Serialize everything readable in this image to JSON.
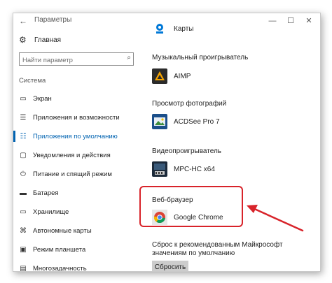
{
  "window": {
    "title": "Параметры"
  },
  "sidebar": {
    "home_label": "Главная",
    "search_placeholder": "Найти параметр",
    "section_label": "Система",
    "items": [
      {
        "label": "Экран",
        "icon": "display-icon"
      },
      {
        "label": "Приложения и возможности",
        "icon": "apps-list-icon"
      },
      {
        "label": "Приложения по умолчанию",
        "icon": "default-apps-icon",
        "active": true
      },
      {
        "label": "Уведомления и действия",
        "icon": "notifications-icon"
      },
      {
        "label": "Питание и спящий режим",
        "icon": "power-icon"
      },
      {
        "label": "Батарея",
        "icon": "battery-icon"
      },
      {
        "label": "Хранилище",
        "icon": "storage-icon"
      },
      {
        "label": "Автономные карты",
        "icon": "offline-maps-icon"
      },
      {
        "label": "Режим планшета",
        "icon": "tablet-mode-icon"
      },
      {
        "label": "Многозадачность",
        "icon": "multitasking-icon"
      }
    ]
  },
  "content": {
    "maps_app": "Карты",
    "music_title": "Музыкальный проигрыватель",
    "music_app": "AIMP",
    "photo_title": "Просмотр фотографий",
    "photo_app": "ACDSee Pro 7",
    "video_title": "Видеопроигрыватель",
    "video_app": "MPC-HC x64",
    "browser_title": "Веб-браузер",
    "browser_app": "Google Chrome",
    "reset_text": "Сброс к рекомендованным Майкрософт значениям по умолчанию",
    "reset_button": "Сбросить"
  },
  "colors": {
    "accent": "#0063b1",
    "highlight": "#d8232a"
  }
}
